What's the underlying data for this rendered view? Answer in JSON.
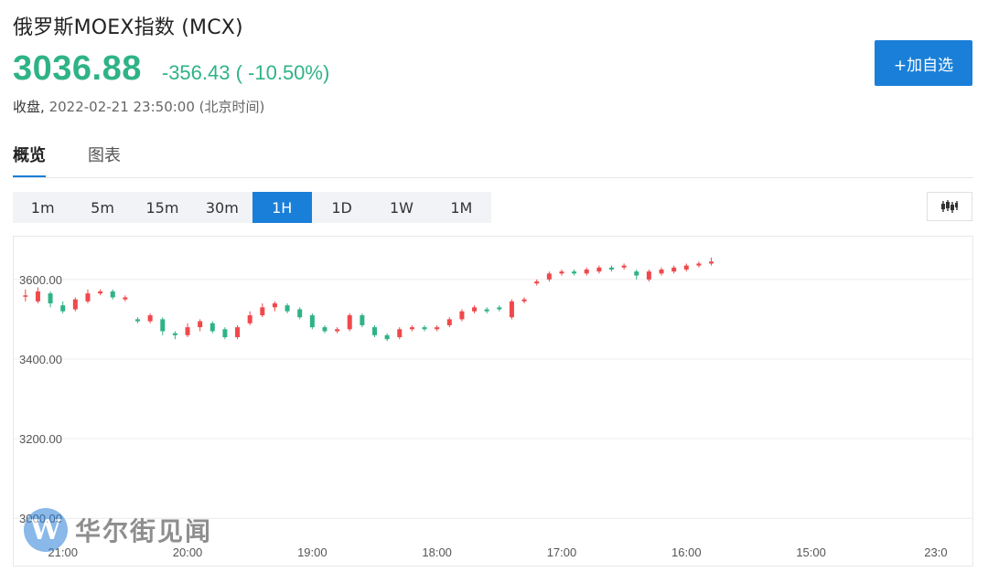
{
  "header": {
    "title": "俄罗斯MOEX指数 (MCX)",
    "price": "3036.88",
    "change": "-356.43 ( -10.50%)",
    "status_label": "收盘,",
    "timestamp": "2022-02-21 23:50:00 (北京时间)",
    "add_button": "+加自选"
  },
  "colors": {
    "up": "#f0484c",
    "down": "#2fb386",
    "accent": "#1a7fd8"
  },
  "tabs": [
    {
      "label": "概览",
      "active": true
    },
    {
      "label": "图表",
      "active": false
    }
  ],
  "periods": [
    {
      "label": "1m",
      "active": false
    },
    {
      "label": "5m",
      "active": false
    },
    {
      "label": "15m",
      "active": false
    },
    {
      "label": "30m",
      "active": false
    },
    {
      "label": "1H",
      "active": true
    },
    {
      "label": "1D",
      "active": false
    },
    {
      "label": "1W",
      "active": false
    },
    {
      "label": "1M",
      "active": false
    }
  ],
  "chart_type_icon": "candlestick-chart-icon",
  "watermark": {
    "logo_letter": "W",
    "text": "华尔街见闻"
  },
  "chart_data": {
    "type": "candlestick",
    "grid": true,
    "ylim": [
      2950,
      3680
    ],
    "y_ticks": [
      3000,
      3200,
      3400,
      3600
    ],
    "y_tick_labels": [
      "3000.00",
      "3200.00",
      "3400.00",
      "3600.00"
    ],
    "x_ticks": [
      {
        "index": 3,
        "label": "21:00"
      },
      {
        "index": 13,
        "label": "20:00"
      },
      {
        "index": 23,
        "label": "19:00"
      },
      {
        "index": 33,
        "label": "18:00"
      },
      {
        "index": 43,
        "label": "17:00"
      },
      {
        "index": 53,
        "label": "16:00"
      },
      {
        "index": 63,
        "label": "15:00"
      },
      {
        "index": 73,
        "label": "23:0"
      }
    ],
    "candles": [
      [
        3560,
        3560,
        3575,
        3545
      ],
      [
        3545,
        3570,
        3580,
        3540
      ],
      [
        3565,
        3540,
        3570,
        3530
      ],
      [
        3535,
        3520,
        3545,
        3515
      ],
      [
        3525,
        3550,
        3555,
        3520
      ],
      [
        3545,
        3565,
        3575,
        3540
      ],
      [
        3565,
        3570,
        3575,
        3560
      ],
      [
        3570,
        3555,
        3575,
        3550
      ],
      [
        3550,
        3555,
        3560,
        3545
      ],
      [
        3500,
        3495,
        3505,
        3490
      ],
      [
        3495,
        3510,
        3515,
        3490
      ],
      [
        3500,
        3470,
        3505,
        3460
      ],
      [
        3465,
        3460,
        3470,
        3450
      ],
      [
        3460,
        3480,
        3490,
        3455
      ],
      [
        3480,
        3495,
        3500,
        3470
      ],
      [
        3490,
        3470,
        3495,
        3465
      ],
      [
        3475,
        3455,
        3480,
        3450
      ],
      [
        3455,
        3480,
        3485,
        3450
      ],
      [
        3490,
        3510,
        3520,
        3485
      ],
      [
        3510,
        3530,
        3540,
        3505
      ],
      [
        3530,
        3540,
        3545,
        3520
      ],
      [
        3535,
        3520,
        3540,
        3515
      ],
      [
        3525,
        3505,
        3530,
        3500
      ],
      [
        3510,
        3480,
        3515,
        3475
      ],
      [
        3480,
        3470,
        3485,
        3465
      ],
      [
        3470,
        3475,
        3480,
        3465
      ],
      [
        3475,
        3510,
        3515,
        3470
      ],
      [
        3510,
        3485,
        3515,
        3480
      ],
      [
        3480,
        3460,
        3485,
        3455
      ],
      [
        3460,
        3450,
        3465,
        3445
      ],
      [
        3455,
        3475,
        3480,
        3450
      ],
      [
        3475,
        3480,
        3485,
        3470
      ],
      [
        3480,
        3475,
        3485,
        3470
      ],
      [
        3475,
        3480,
        3485,
        3470
      ],
      [
        3485,
        3500,
        3505,
        3480
      ],
      [
        3500,
        3520,
        3525,
        3495
      ],
      [
        3520,
        3530,
        3535,
        3515
      ],
      [
        3525,
        3520,
        3530,
        3515
      ],
      [
        3530,
        3525,
        3535,
        3520
      ],
      [
        3505,
        3545,
        3550,
        3500
      ],
      [
        3545,
        3550,
        3555,
        3540
      ],
      [
        3590,
        3595,
        3600,
        3585
      ],
      [
        3600,
        3615,
        3620,
        3595
      ],
      [
        3615,
        3620,
        3625,
        3610
      ],
      [
        3620,
        3615,
        3625,
        3610
      ],
      [
        3615,
        3625,
        3630,
        3610
      ],
      [
        3620,
        3630,
        3635,
        3615
      ],
      [
        3630,
        3625,
        3635,
        3620
      ],
      [
        3630,
        3635,
        3640,
        3625
      ],
      [
        3620,
        3610,
        3625,
        3600
      ],
      [
        3600,
        3620,
        3625,
        3595
      ],
      [
        3615,
        3625,
        3630,
        3610
      ],
      [
        3620,
        3630,
        3635,
        3615
      ],
      [
        3625,
        3635,
        3640,
        3620
      ],
      [
        3635,
        3640,
        3645,
        3630
      ],
      [
        3640,
        3645,
        3655,
        3635
      ]
    ]
  }
}
